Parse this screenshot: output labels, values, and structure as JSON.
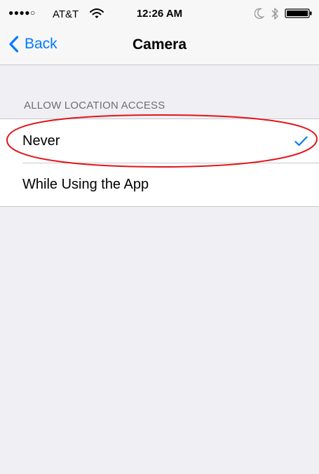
{
  "status_bar": {
    "signal": "●●●●○",
    "carrier": "AT&T",
    "wifi_icon": "wifi-icon",
    "time": "12:26 AM",
    "moon_icon": "moon-icon",
    "bluetooth_icon": "bluetooth-icon",
    "battery_icon": "battery-icon"
  },
  "nav": {
    "back_icon": "chevron-left-icon",
    "back_label": "Back",
    "title": "Camera"
  },
  "section": {
    "header": "ALLOW LOCATION ACCESS",
    "options": [
      {
        "label": "Never",
        "selected": true
      },
      {
        "label": "While Using the App",
        "selected": false
      }
    ],
    "selected_icon": "checkmark-icon"
  },
  "colors": {
    "accent": "#007aff",
    "background": "#efeff4",
    "annotation": "#e0151b"
  }
}
